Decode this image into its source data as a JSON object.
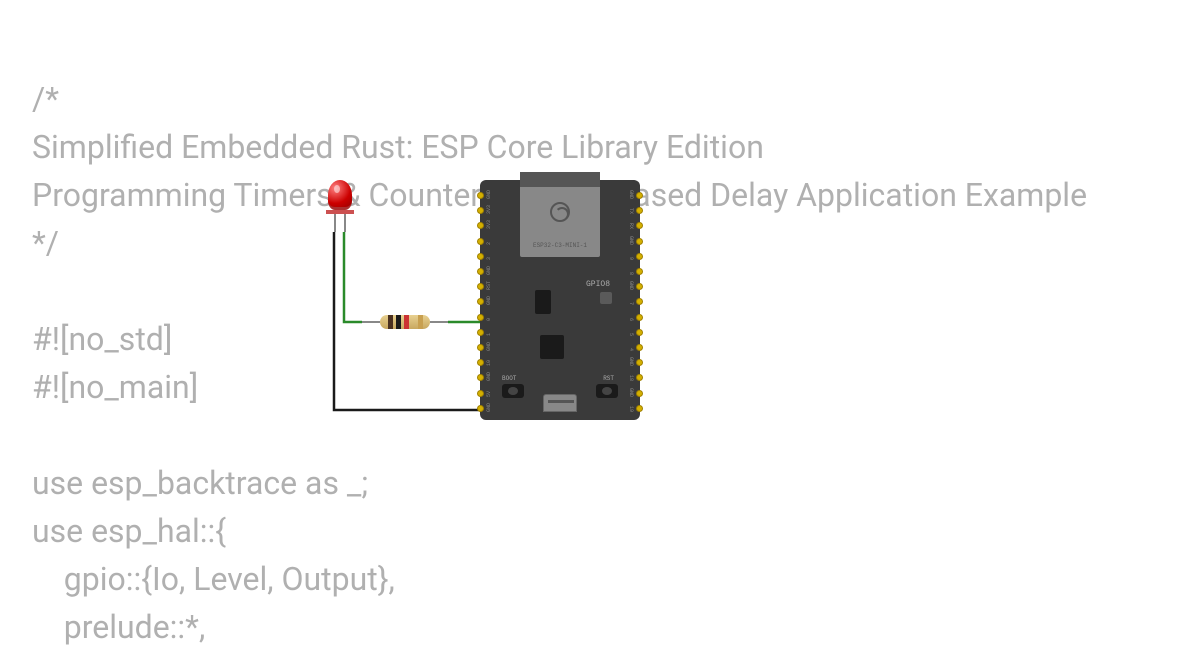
{
  "code": {
    "line1": "/*",
    "line2": "Simplified Embedded Rust: ESP Core Library Edition",
    "line3": "Programming Timers & Counters - Timer-Based Delay Application Example",
    "line4": "*/",
    "line5": "",
    "line6": "#![no_std]",
    "line7": "#![no_main]",
    "line8": "",
    "line9": "use esp_backtrace as _;",
    "line10": "use esp_hal::{",
    "line11": "    gpio::{Io, Level, Output},",
    "line12": "    prelude::*,"
  },
  "board": {
    "chip_name": "ESP32-C3-MINI-1",
    "gpio_label": "GPIO8",
    "boot_label": "BOOT",
    "rst_label": "RST",
    "pins_left": [
      "GND",
      "3V3",
      "3V3",
      "2",
      "3",
      "GND",
      "RST",
      "GND",
      "0",
      "1",
      "GND",
      "10",
      "GND",
      "5V",
      "GND"
    ],
    "pins_right": [
      "GND",
      "TX",
      "RX",
      "GND",
      "9",
      "8",
      "GND",
      "7",
      "6",
      "5",
      "4",
      "GND",
      "18",
      "GND",
      "19"
    ]
  },
  "components": {
    "led_color": "#cc0000",
    "resistor_bands": [
      "brown",
      "black",
      "red",
      "gold"
    ]
  }
}
